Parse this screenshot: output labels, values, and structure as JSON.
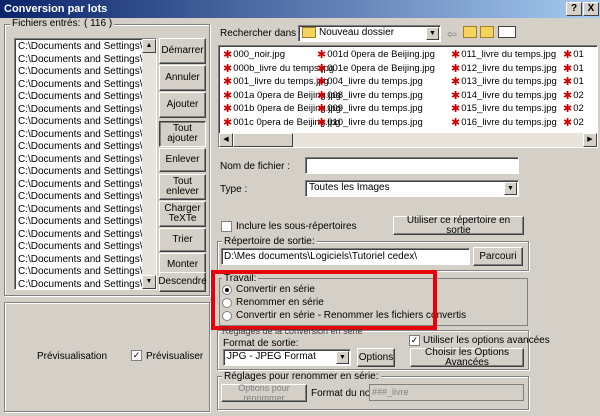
{
  "window": {
    "title": "Conversion par lots",
    "help_button": "?",
    "close_button": "X"
  },
  "input_files": {
    "label": "Fichiers entrés:",
    "count": "( 116 )",
    "items": [
      "C:\\Documents and Settings\\Admini",
      "C:\\Documents and Settings\\Admini",
      "C:\\Documents and Settings\\Admini",
      "C:\\Documents and Settings\\Admini",
      "C:\\Documents and Settings\\Admini",
      "C:\\Documents and Settings\\Admini",
      "C:\\Documents and Settings\\Admini",
      "C:\\Documents and Settings\\Admini",
      "C:\\Documents and Settings\\Admini",
      "C:\\Documents and Settings\\Admini",
      "C:\\Documents and Settings\\Admini",
      "C:\\Documents and Settings\\Admini",
      "C:\\Documents and Settings\\Admini",
      "C:\\Documents and Settings\\Admini",
      "C:\\Documents and Settings\\Admini",
      "C:\\Documents and Settings\\Admini",
      "C:\\Documents and Settings\\Admini",
      "C:\\Documents and Settings\\Admini",
      "C:\\Documents and Settings\\Admini",
      "C:\\Documents and Settings\\Admini",
      "C:\\Documents and Settings\\Admini"
    ]
  },
  "side_buttons": {
    "start": "Démarrer",
    "cancel": "Annuler",
    "add": "Ajouter",
    "add_all_1": "Tout",
    "add_all_2": "ajouter",
    "remove": "Enlever",
    "remove_all_1": "Tout",
    "remove_all_2": "enlever",
    "load_1": "Charger",
    "load_2": "TeXTe",
    "sort": "Trier",
    "up": "Monter",
    "down": "Descendre"
  },
  "browse": {
    "search_label": "Rechercher dans :",
    "folder": "Nouveau dossier",
    "files": [
      [
        "000_noir.jpg",
        "001d 0pera de Beijing.jpg",
        "011_livre du temps.jpg",
        "01"
      ],
      [
        "000b_livre du temps.jpg",
        "001e 0pera de Beijing.jpg",
        "012_livre du temps.jpg",
        "01"
      ],
      [
        "001_livre du temps.jpg",
        "004_livre du temps.jpg",
        "013_livre du temps.jpg",
        "01"
      ],
      [
        "001a 0pera de Beijing.jpg",
        "008_livre du temps.jpg",
        "014_livre du temps.jpg",
        "02"
      ],
      [
        "001b 0pera de Beijing.jpg",
        "009_livre du temps.jpg",
        "015_livre du temps.jpg",
        "02"
      ],
      [
        "001c 0pera de Beijing.jpg",
        "010_livre du temps.jpg",
        "016_livre du temps.jpg",
        "02"
      ]
    ],
    "filename_label": "Nom de fichier :",
    "filename_value": "",
    "type_label": "Type :",
    "type_value": "Toutes les Images"
  },
  "subfolders": {
    "label": "Inclure les sous-répertoires",
    "checked": false,
    "use_dir_button": "Utiliser ce répertoire en sortie"
  },
  "output": {
    "label": "Répertoire de sortie:",
    "path": "D:\\Mes documents\\Logiciels\\Tutoriel cedex\\",
    "browse_button": "Parcouri"
  },
  "work": {
    "label": "Travail:",
    "options": [
      "Convertir en série",
      "Renommer en série",
      "Convertir en série - Renommer les fichiers convertis"
    ],
    "selected": 0,
    "settings_label": "Réglages de la conversion en série"
  },
  "preview": {
    "label": "Prévisualisation",
    "checkbox_label": "Prévisualiser",
    "checked": true
  },
  "format": {
    "label": "Format de sortie:",
    "value": "JPG - JPEG Format",
    "options_button": "Options",
    "advanced_label": "Utiliser les options avancées",
    "advanced_checked": true,
    "advanced_button": "Choisir les Options Avancées"
  },
  "rename": {
    "label": "Réglages pour renommer en série:",
    "button": "Options pour renommer",
    "format_label": "Format du nom:",
    "format_value": "###_livre"
  },
  "colors": {
    "highlight": "#e8000a",
    "title_start": "#0a246a",
    "title_end": "#a6caf0"
  }
}
